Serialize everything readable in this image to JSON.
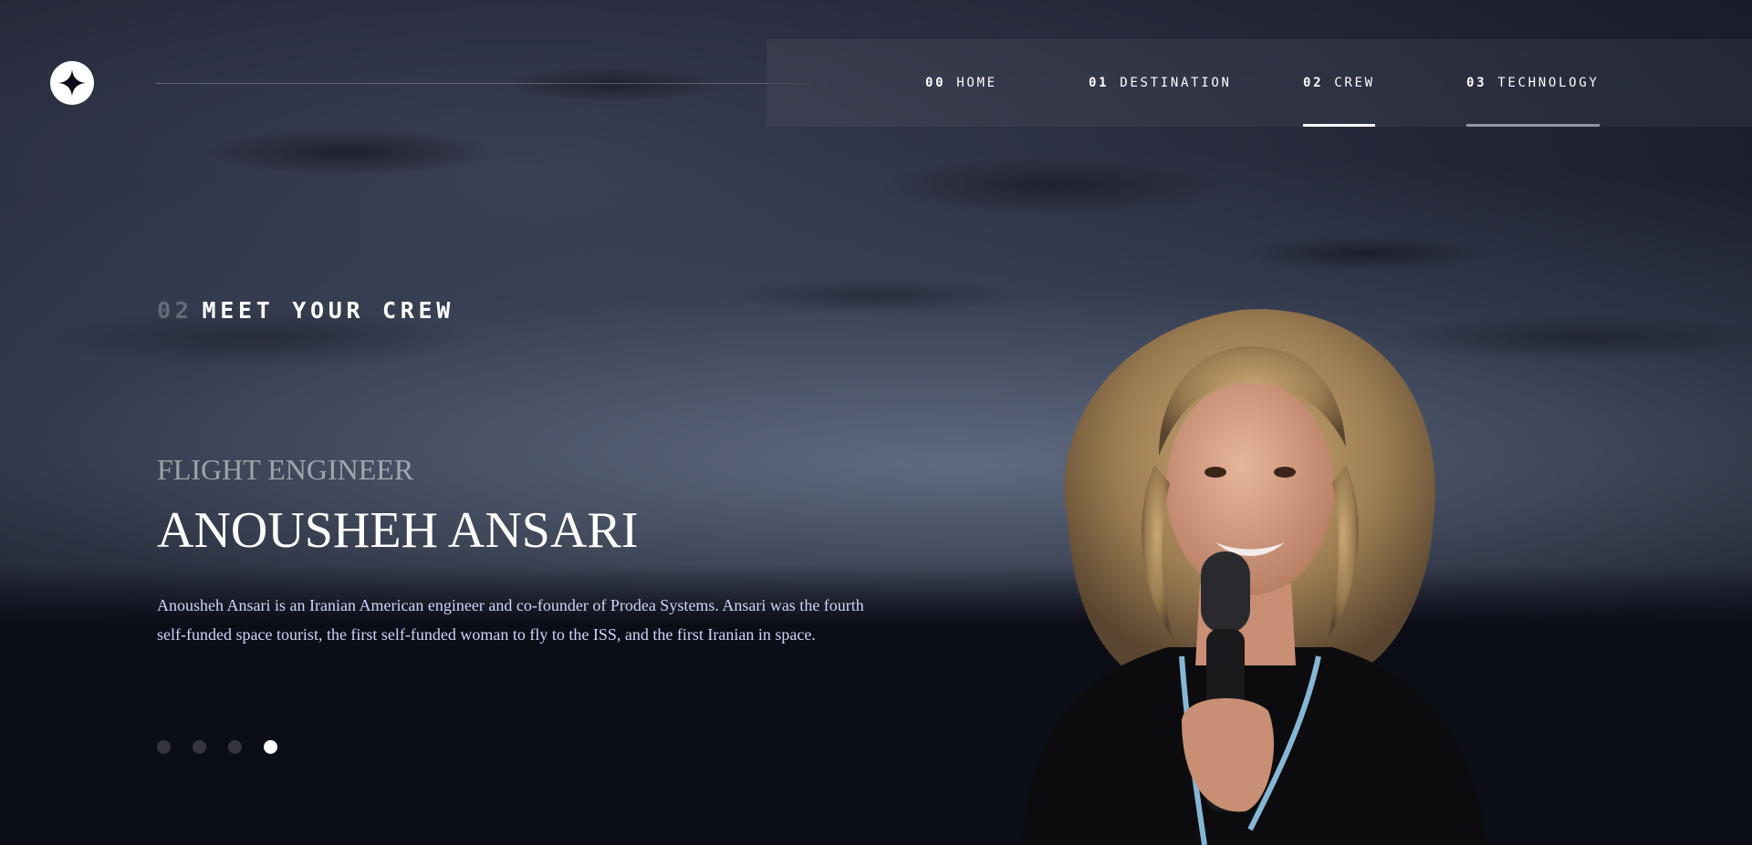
{
  "nav": {
    "items": [
      {
        "num": "00",
        "label": "HOME"
      },
      {
        "num": "01",
        "label": "DESTINATION"
      },
      {
        "num": "02",
        "label": "CREW"
      },
      {
        "num": "03",
        "label": "TECHNOLOGY"
      }
    ],
    "active_index": 2
  },
  "page": {
    "eyebrow_num": "02",
    "eyebrow_text": "MEET YOUR CREW"
  },
  "crew": {
    "role": "FLIGHT ENGINEER",
    "name": "ANOUSHEH ANSARI",
    "bio": "Anousheh Ansari is an Iranian American engineer and co-founder of Prodea Systems. Ansari was the fourth self-funded space tourist, the first self-funded woman to fly to the ISS, and the first Iranian in space.",
    "slides_total": 4,
    "active_slide": 4
  },
  "icons": {
    "logo": "star-logo-icon"
  },
  "colors": {
    "background": "#0b0d17",
    "text": "#ffffff",
    "bio_text": "#d0d6f9"
  }
}
